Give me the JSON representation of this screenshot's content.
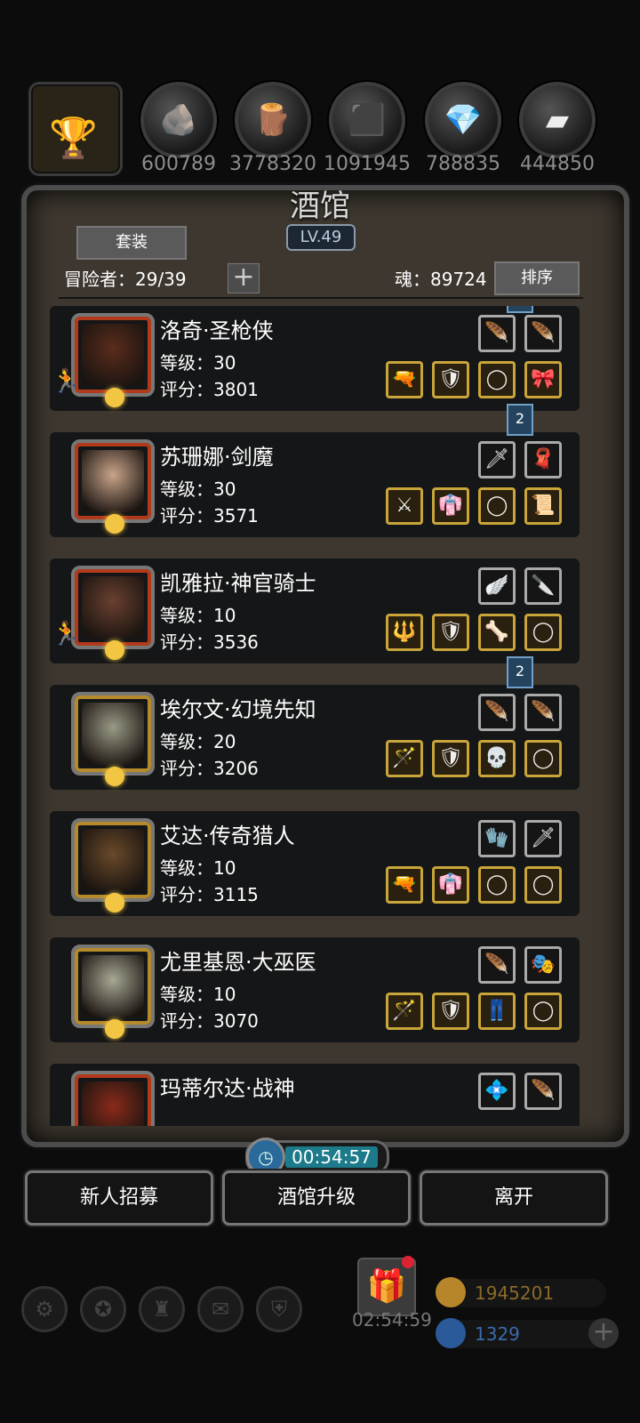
{
  "resources": [
    {
      "name": "ore-icon",
      "glyph": "🪨",
      "amount": "600789"
    },
    {
      "name": "wood-icon",
      "glyph": "🪵",
      "amount": "3778320"
    },
    {
      "name": "iron-icon",
      "glyph": "⬛",
      "amount": "1091945"
    },
    {
      "name": "crystal-icon",
      "glyph": "💎",
      "amount": "788835"
    },
    {
      "name": "steel-icon",
      "glyph": "▰",
      "amount": "444850"
    }
  ],
  "panel": {
    "title": "酒馆",
    "level": "LV.49",
    "set_button": "套装",
    "adventurers_label": "冒险者：29/39",
    "plus": "+",
    "soul_label": "魂：89724",
    "sort_button": "排序"
  },
  "heroes": [
    {
      "name": "洛奇·圣枪侠",
      "level": "等级：30",
      "score": "评分：3801",
      "frame": "red",
      "face_color": "#5a2c1c",
      "runner": true,
      "ribbon": "",
      "top_slots": [
        "🪶",
        "🪶"
      ],
      "equip": [
        "🔫",
        "🛡",
        "◯",
        "🎀"
      ]
    },
    {
      "name": "苏珊娜·剑魔",
      "level": "等级：30",
      "score": "评分：3571",
      "frame": "red",
      "face_color": "#c9a48a",
      "runner": false,
      "ribbon": "2",
      "top_slots": [
        "🗡",
        "🧣"
      ],
      "equip": [
        "⚔",
        "👘",
        "◯",
        "📜"
      ]
    },
    {
      "name": "凯雅拉·神官骑士",
      "level": "等级：10",
      "score": "评分：3536",
      "frame": "red",
      "face_color": "#6a4030",
      "runner": true,
      "ribbon": "",
      "top_slots": [
        "🪽",
        "🔪"
      ],
      "equip": [
        "🔱",
        "🛡",
        "🦴",
        "◯"
      ]
    },
    {
      "name": "埃尔文·幻境先知",
      "level": "等级：20",
      "score": "评分：3206",
      "frame": "gold",
      "face_color": "#9a9a86",
      "runner": false,
      "ribbon": "2",
      "top_slots": [
        "🪶",
        "🪶"
      ],
      "equip": [
        "🪄",
        "🛡",
        "💀",
        "◯"
      ]
    },
    {
      "name": "艾达·传奇猎人",
      "level": "等级：10",
      "score": "评分：3115",
      "frame": "gold",
      "face_color": "#6a4a2a",
      "runner": false,
      "ribbon": "",
      "top_slots": [
        "🧤",
        "🗡"
      ],
      "equip": [
        "🔫",
        "👘",
        "◯",
        "◯"
      ]
    },
    {
      "name": "尤里基恩·大巫医",
      "level": "等级：10",
      "score": "评分：3070",
      "frame": "gold",
      "face_color": "#a8a894",
      "runner": false,
      "ribbon": "",
      "top_slots": [
        "🪶",
        "🎭"
      ],
      "equip": [
        "🪄",
        "🛡",
        "👖",
        "◯"
      ]
    },
    {
      "name": "玛蒂尔达·战神",
      "level": "",
      "score": "",
      "frame": "red",
      "face_color": "#8a2a1a",
      "runner": false,
      "ribbon": "",
      "top_slots": [
        "💠",
        "🪶"
      ],
      "equip": []
    }
  ],
  "timer": "00:54:57",
  "buttons": {
    "recruit": "新人招募",
    "upgrade": "酒馆升级",
    "leave": "离开"
  },
  "footer": {
    "gift_timer": "02:54:59",
    "gold": "1945201",
    "gems": "1329",
    "gold_color": "#c8962a",
    "gem_color": "#3a7acc"
  }
}
